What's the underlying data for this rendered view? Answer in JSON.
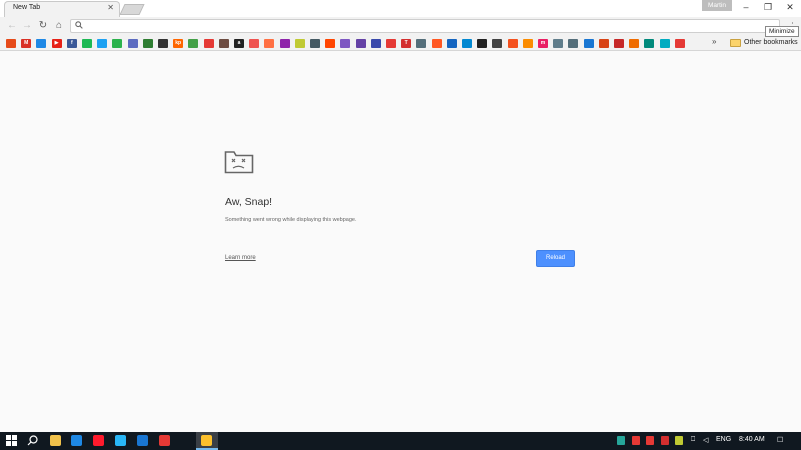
{
  "window": {
    "tab_title": "New Tab",
    "profile_name": "Martin",
    "tooltip": "Minimize",
    "minimize_icon": "–",
    "maximize_icon": "❐",
    "close_icon": "✕",
    "tab_close_icon": "✕"
  },
  "toolbar": {
    "back_icon": "←",
    "forward_icon": "→",
    "reload_icon": "↻",
    "home_icon": "⌂",
    "omnibox_value": "",
    "menu_icon": "⋮"
  },
  "bookmarks": {
    "overflow_icon": "»",
    "other_label": "Other bookmarks",
    "items": [
      {
        "name": "apps",
        "color": "#e64a19",
        "glyph": ""
      },
      {
        "name": "gmail",
        "color": "#d93025",
        "glyph": "M"
      },
      {
        "name": "drive",
        "color": "#1e88e5",
        "glyph": ""
      },
      {
        "name": "youtube",
        "color": "#e62117",
        "glyph": "▶"
      },
      {
        "name": "facebook",
        "color": "#3b5998",
        "glyph": "f"
      },
      {
        "name": "spotify",
        "color": "#1db954",
        "glyph": ""
      },
      {
        "name": "twitter",
        "color": "#1da1f2",
        "glyph": ""
      },
      {
        "name": "feedly",
        "color": "#2bb24c",
        "glyph": ""
      },
      {
        "name": "bookmark-9",
        "color": "#5c6bc0",
        "glyph": ""
      },
      {
        "name": "bookmark-10",
        "color": "#2e7d32",
        "glyph": ""
      },
      {
        "name": "bookmark-11",
        "color": "#333333",
        "glyph": ""
      },
      {
        "name": "kinopoisk",
        "color": "#ff6600",
        "glyph": "kp"
      },
      {
        "name": "bookmark-13",
        "color": "#43a047",
        "glyph": ""
      },
      {
        "name": "bookmark-14",
        "color": "#e53935",
        "glyph": ""
      },
      {
        "name": "bookmark-15",
        "color": "#6d4c41",
        "glyph": ""
      },
      {
        "name": "amazon",
        "color": "#222222",
        "glyph": "a"
      },
      {
        "name": "bookmark-17",
        "color": "#ef5350",
        "glyph": ""
      },
      {
        "name": "bookmark-18",
        "color": "#ff7043",
        "glyph": ""
      },
      {
        "name": "bookmark-19",
        "color": "#8e24aa",
        "glyph": ""
      },
      {
        "name": "bookmark-20",
        "color": "#c0ca33",
        "glyph": ""
      },
      {
        "name": "bookmark-21",
        "color": "#455a64",
        "glyph": ""
      },
      {
        "name": "reddit",
        "color": "#ff4500",
        "glyph": ""
      },
      {
        "name": "bookmark-23",
        "color": "#7e57c2",
        "glyph": ""
      },
      {
        "name": "twitch",
        "color": "#6441a5",
        "glyph": ""
      },
      {
        "name": "bookmark-25",
        "color": "#3949ab",
        "glyph": ""
      },
      {
        "name": "bookmark-26",
        "color": "#e53935",
        "glyph": ""
      },
      {
        "name": "bookmark-27",
        "color": "#d32f2f",
        "glyph": "T"
      },
      {
        "name": "bookmark-28",
        "color": "#546e7a",
        "glyph": ""
      },
      {
        "name": "bookmark-29",
        "color": "#ff5722",
        "glyph": ""
      },
      {
        "name": "bookmark-30",
        "color": "#1565c0",
        "glyph": ""
      },
      {
        "name": "bookmark-31",
        "color": "#0288d1",
        "glyph": ""
      },
      {
        "name": "bookmark-32",
        "color": "#212121",
        "glyph": ""
      },
      {
        "name": "bookmark-33",
        "color": "#424242",
        "glyph": ""
      },
      {
        "name": "bookmark-34",
        "color": "#f4511e",
        "glyph": ""
      },
      {
        "name": "bookmark-35",
        "color": "#fb8c00",
        "glyph": ""
      },
      {
        "name": "bookmark-36",
        "color": "#e91e63",
        "glyph": "m"
      },
      {
        "name": "bookmark-37",
        "color": "#607d8b",
        "glyph": ""
      },
      {
        "name": "bookmark-38",
        "color": "#546e7a",
        "glyph": ""
      },
      {
        "name": "bookmark-39",
        "color": "#1976d2",
        "glyph": ""
      },
      {
        "name": "bookmark-40",
        "color": "#d84315",
        "glyph": ""
      },
      {
        "name": "bookmark-41",
        "color": "#c62828",
        "glyph": ""
      },
      {
        "name": "bookmark-42",
        "color": "#ef6c00",
        "glyph": ""
      },
      {
        "name": "bookmark-43",
        "color": "#00897b",
        "glyph": ""
      },
      {
        "name": "bookmark-44",
        "color": "#00acc1",
        "glyph": ""
      },
      {
        "name": "bookmark-45",
        "color": "#e53935",
        "glyph": ""
      }
    ]
  },
  "page": {
    "title": "Aw, Snap!",
    "message": "Something went wrong while displaying this webpage.",
    "learn_more": "Learn more",
    "reload_label": "Reload"
  },
  "taskbar": {
    "apps": [
      {
        "name": "start",
        "color": "#ffffff"
      },
      {
        "name": "search",
        "color": "#ffffff"
      },
      {
        "name": "file-explorer",
        "color": "#f0c14b"
      },
      {
        "name": "edge",
        "color": "#1e88e5"
      },
      {
        "name": "opera",
        "color": "#ff1b2d"
      },
      {
        "name": "app-5",
        "color": "#29b6f6"
      },
      {
        "name": "app-6",
        "color": "#1976d2"
      },
      {
        "name": "app-7",
        "color": "#e53935"
      },
      {
        "name": "chrome",
        "color": "#fbc02d"
      }
    ],
    "tray": [
      {
        "name": "tray-1",
        "color": "#26a69a"
      },
      {
        "name": "tray-2",
        "color": "#e53935"
      },
      {
        "name": "tray-3",
        "color": "#e53935"
      },
      {
        "name": "tray-4",
        "color": "#d32f2f"
      },
      {
        "name": "tray-5",
        "color": "#c0ca33"
      }
    ],
    "network_icon": "⎕",
    "volume_icon": "◁",
    "language": "ENG",
    "time": "8:40 AM",
    "notification_icon": "☐"
  }
}
